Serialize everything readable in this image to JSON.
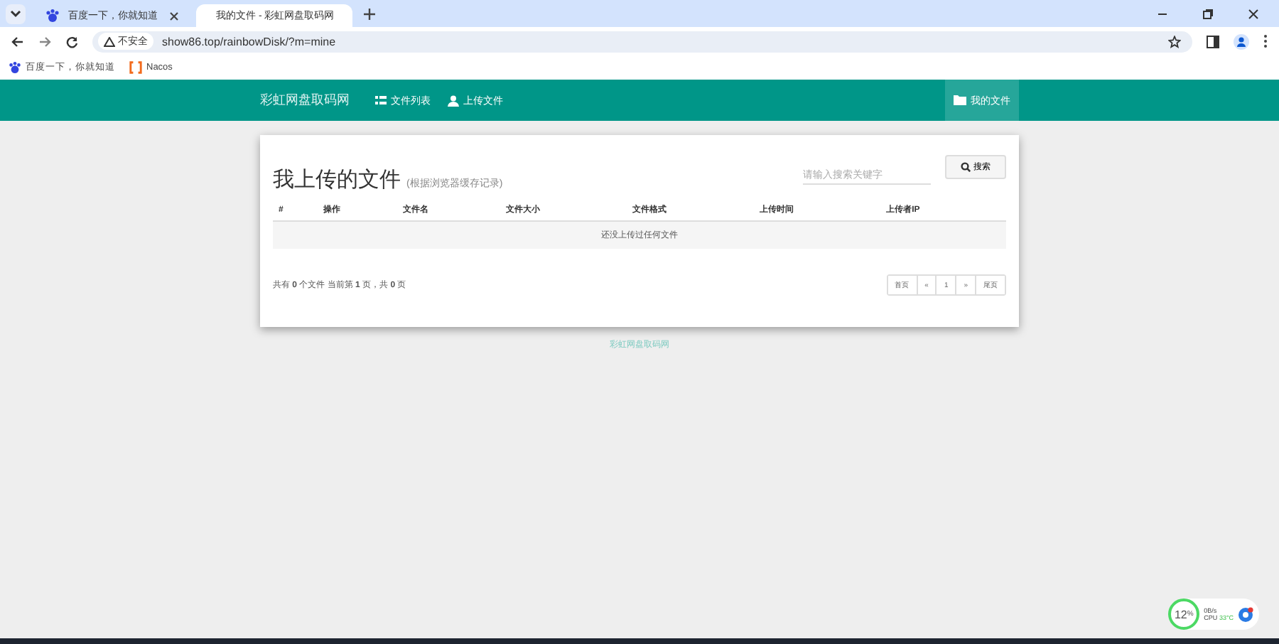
{
  "browser": {
    "tabs": [
      {
        "title": "百度一下，你就知道",
        "selected": false
      },
      {
        "title": "我的文件 - 彩虹网盘取码网",
        "selected": true
      }
    ],
    "address": {
      "security": "不安全",
      "url": "show86.top/rainbowDisk/?m=mine"
    },
    "bookmarks": [
      "百度一下，你就知道",
      "Nacos"
    ]
  },
  "navbar": {
    "brand": "彩虹网盘取码网",
    "items": [
      {
        "label": "文件列表",
        "selected": false
      },
      {
        "label": "上传文件",
        "selected": false
      }
    ],
    "right_item": {
      "label": "我的文件",
      "selected": true
    }
  },
  "panel": {
    "title": "我上传的文件",
    "subtitle": "(根据浏览器缓存记录)",
    "search": {
      "placeholder": "请输入搜索关键字"
    },
    "search_button": "搜索",
    "table": {
      "columns": [
        "#",
        "操作",
        "文件名",
        "文件大小",
        "文件格式",
        "上传时间",
        "上传者IP"
      ],
      "empty_message": "还没上传过任何文件"
    },
    "summary": "共有 **0** 个文件  当前第 **1** 页，共 **0** 页",
    "pagination": [
      "首页",
      "«",
      "1",
      "»",
      "尾页"
    ]
  },
  "footer": "彩虹网盘取码网",
  "monitor": {
    "percent": "12",
    "unit": "%",
    "speed": "0B/s",
    "cpu_label": "CPU",
    "cpu_temp": "33°C"
  }
}
